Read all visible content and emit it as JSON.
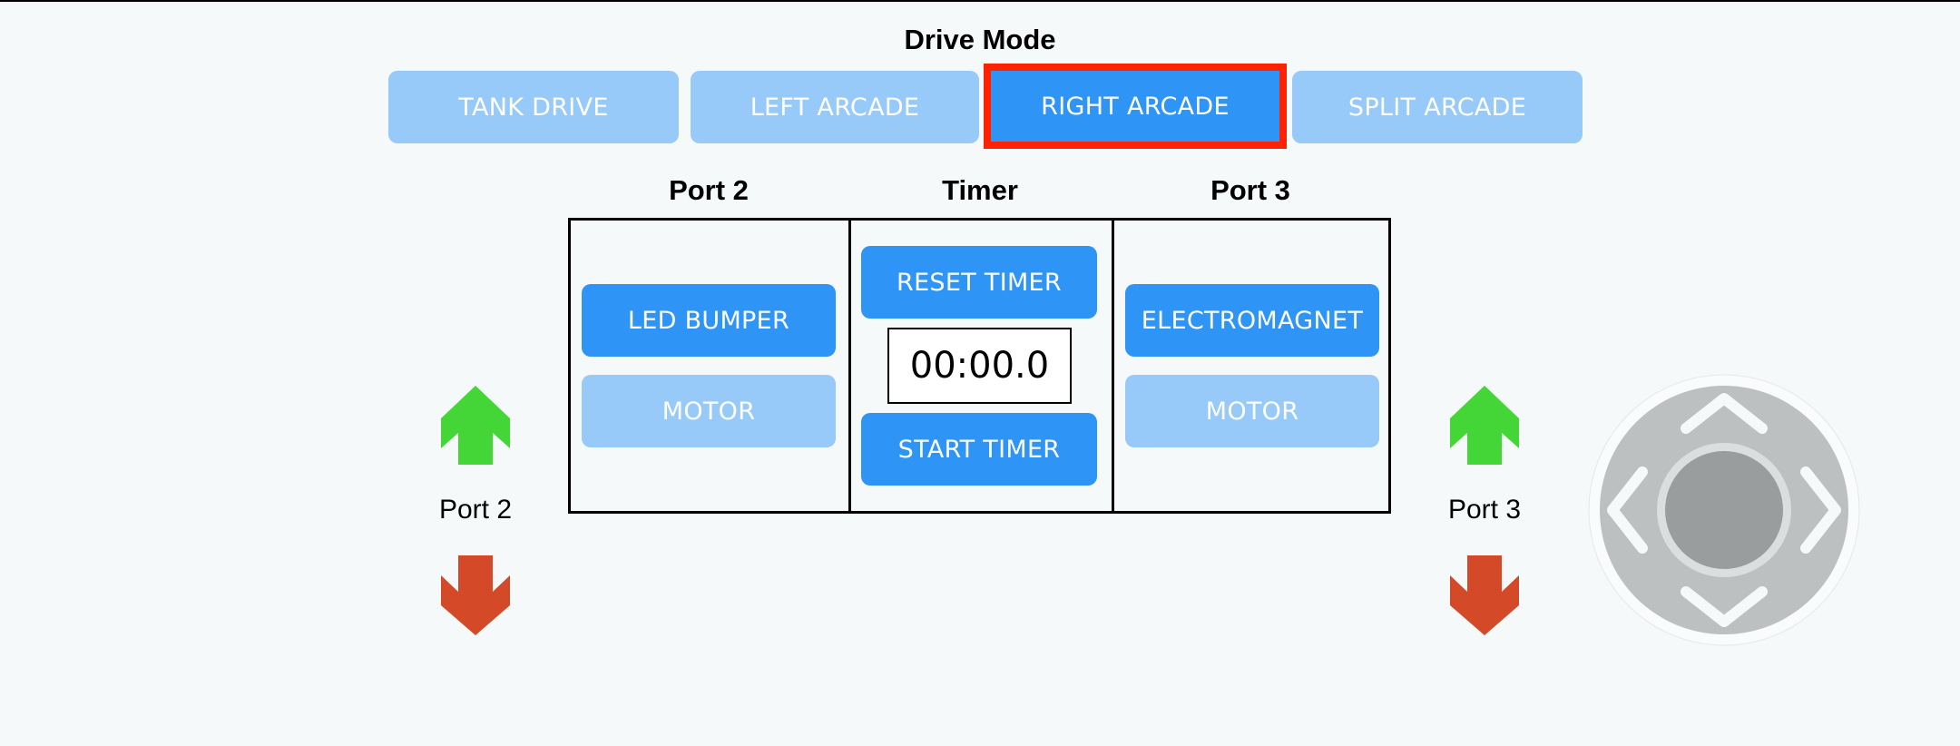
{
  "drive_mode": {
    "title": "Drive Mode",
    "options": [
      {
        "label": "TANK DRIVE",
        "active": false
      },
      {
        "label": "LEFT ARCADE",
        "active": false
      },
      {
        "label": "RIGHT ARCADE",
        "active": true
      },
      {
        "label": "SPLIT ARCADE",
        "active": false
      }
    ],
    "highlighted_option": "RIGHT ARCADE"
  },
  "panel": {
    "columns": [
      {
        "header": "Port 2",
        "buttons": [
          {
            "label": "LED BUMPER",
            "active": true
          },
          {
            "label": "MOTOR",
            "active": false
          }
        ]
      },
      {
        "header": "Timer",
        "reset_label": "RESET TIMER",
        "display": "00:00.0",
        "start_label": "START TIMER"
      },
      {
        "header": "Port 3",
        "buttons": [
          {
            "label": "ELECTROMAGNET",
            "active": true
          },
          {
            "label": "MOTOR",
            "active": false
          }
        ]
      }
    ]
  },
  "port_controls": {
    "left": {
      "label": "Port 2",
      "up_icon": "arrow-up-icon",
      "down_icon": "arrow-down-icon"
    },
    "right": {
      "label": "Port 3",
      "up_icon": "arrow-up-icon",
      "down_icon": "arrow-down-icon"
    }
  },
  "joystick": {
    "icon": "directional-joystick-icon"
  },
  "colors": {
    "background": "#f5f9fa",
    "button_active": "#2e95f6",
    "button_inactive": "#97caf9",
    "highlight": "#ff2200",
    "arrow_up": "#44d636",
    "arrow_down": "#d44a28",
    "joystick_base": "#bcc0c1",
    "joystick_knob": "#9a9d9e"
  }
}
